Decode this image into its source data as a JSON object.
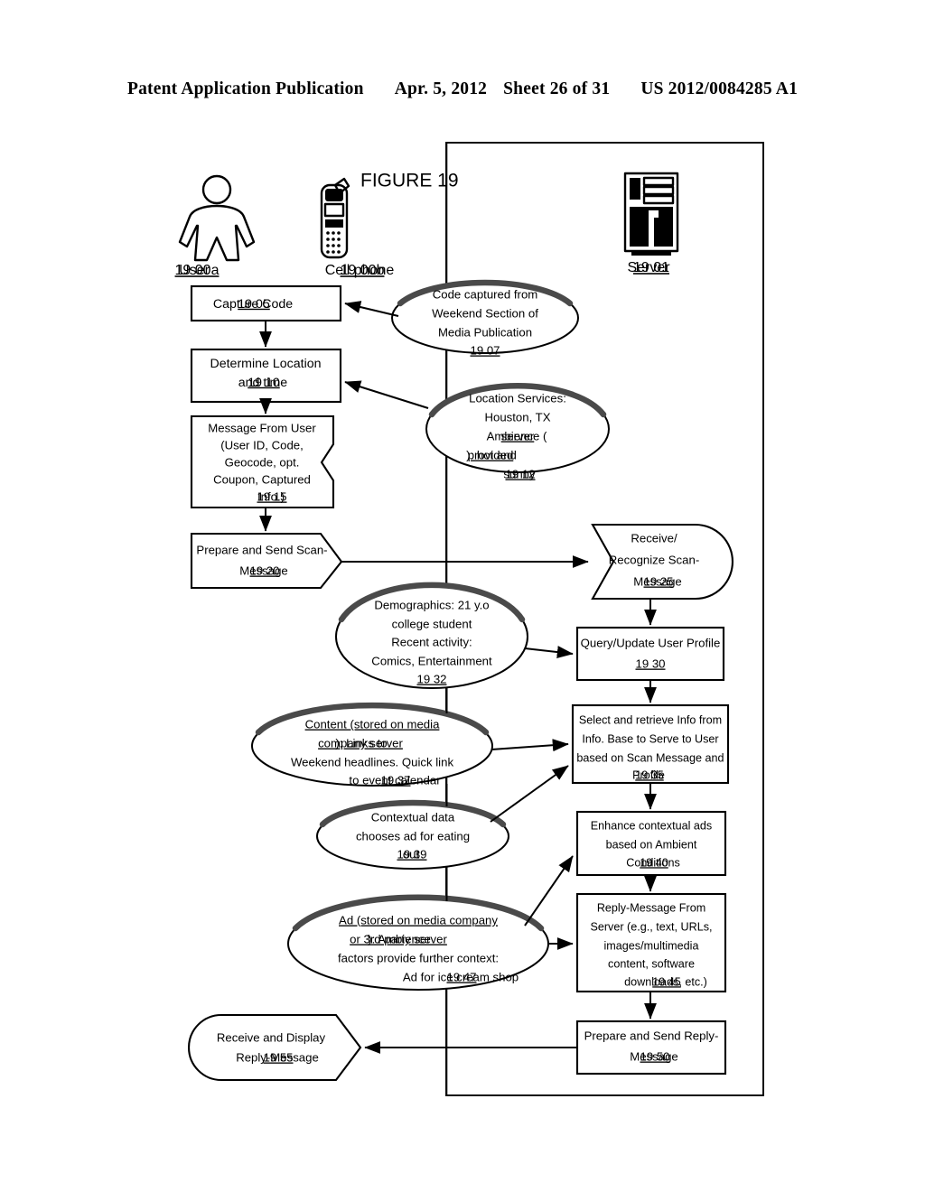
{
  "header": {
    "publication": "Patent Application Publication",
    "date": "Apr. 5, 2012",
    "sheet": "Sheet 26 of 31",
    "number": "US 2012/0084285 A1"
  },
  "figure": {
    "title": "FIGURE 19",
    "actors": [
      {
        "id": "user",
        "icon": "person-icon",
        "label": "User ",
        "ref": "19 00a"
      },
      {
        "id": "phone",
        "icon": "cellphone-icon",
        "label": "Cell phone ",
        "ref": "19 00b"
      },
      {
        "id": "server",
        "icon": "server-icon",
        "label": "Server ",
        "ref": "19 01"
      }
    ],
    "nodes": [
      {
        "id": "n1905",
        "shape": "rect",
        "column": "left",
        "lines": [
          {
            "text": "Capture Code ",
            "ref": "19 05"
          }
        ]
      },
      {
        "id": "n1910",
        "shape": "rect",
        "column": "left",
        "lines": [
          {
            "text": "Determine Location"
          },
          {
            "text": "and time ",
            "ref": "19 10"
          }
        ]
      },
      {
        "id": "n1915",
        "shape": "document",
        "column": "left",
        "lines": [
          {
            "text": "Message From User"
          },
          {
            "text": "(User ID, Code,"
          },
          {
            "text": "Geocode, opt."
          },
          {
            "text": "Coupon, Captured"
          },
          {
            "text": "Info.) ",
            "ref": "19 15"
          }
        ]
      },
      {
        "id": "n1920",
        "shape": "send-arrow",
        "column": "left",
        "lines": [
          {
            "text": "Prepare and Send Scan-"
          },
          {
            "text": "Message ",
            "ref": "19 20"
          }
        ]
      },
      {
        "id": "n1955",
        "shape": "receive-display",
        "column": "left",
        "lines": [
          {
            "text": "Receive and Display"
          },
          {
            "text": "Reply-Message ",
            "ref": "19 55"
          }
        ]
      },
      {
        "id": "n1925",
        "shape": "receive-chevron",
        "column": "right",
        "lines": [
          {
            "text": "Receive/"
          },
          {
            "text": "Recognize Scan-"
          },
          {
            "text": "Message ",
            "ref": "19 25"
          }
        ]
      },
      {
        "id": "n1930",
        "shape": "rect",
        "column": "right",
        "lines": [
          {
            "text": "Query/Update User Profile"
          },
          {
            "text": "",
            "ref": "19 30"
          }
        ]
      },
      {
        "id": "n1935",
        "shape": "rect",
        "column": "right",
        "lines": [
          {
            "text": "Select and retrieve Info from"
          },
          {
            "text": "Info. Base to Serve to User"
          },
          {
            "text": "based on Scan Message and"
          },
          {
            "text": "Profile ",
            "ref": "19 35"
          }
        ]
      },
      {
        "id": "n1940",
        "shape": "rect",
        "column": "right",
        "lines": [
          {
            "text": "Enhance contextual ads"
          },
          {
            "text": "based on Ambient"
          },
          {
            "text": "Conditions ",
            "ref": "19 40"
          }
        ]
      },
      {
        "id": "n1945",
        "shape": "rect",
        "column": "right",
        "lines": [
          {
            "text": "Reply-Message From"
          },
          {
            "text": "Server (e.g., text, URLs,"
          },
          {
            "text": "images/multimedia"
          },
          {
            "text": "content, software"
          },
          {
            "text": "downloads, etc.) ",
            "ref": "19 45"
          }
        ]
      },
      {
        "id": "n1950",
        "shape": "rect",
        "column": "right",
        "lines": [
          {
            "text": "Prepare and Send Reply-"
          },
          {
            "text": "Message ",
            "ref": "19 50"
          }
        ]
      }
    ],
    "ellipses": [
      {
        "id": "e1907",
        "lines": [
          {
            "text": "Code captured from"
          },
          {
            "text": "Weekend Section of"
          },
          {
            "text": "Media Publication"
          },
          {
            "text": "",
            "ref": "19 07"
          }
        ]
      },
      {
        "id": "e1912",
        "lines": [
          {
            "text": "Location Services:"
          },
          {
            "text": "Houston, TX"
          },
          {
            "text": "Ambience (",
            "under": "server",
            "tail": ""
          },
          {
            "under": "provided",
            "tail": "): hot and"
          },
          {
            "text": "sunny ",
            "ref": "19 12"
          }
        ]
      },
      {
        "id": "e1932",
        "lines": [
          {
            "text": "Demographics: 21 y.o"
          },
          {
            "text": "college student"
          },
          {
            "text": "Recent activity:"
          },
          {
            "text": "Comics, Entertainment"
          },
          {
            "text": "",
            "ref": "19 32"
          }
        ]
      },
      {
        "id": "e1937",
        "lines": [
          {
            "under": "Content (stored on media",
            "tail": ""
          },
          {
            "under": "company server",
            "tail": "): Links to"
          },
          {
            "text": "Weekend headlines. Quick link"
          },
          {
            "text": "to event calendar ",
            "ref": "19 37"
          }
        ]
      },
      {
        "id": "e1939",
        "lines": [
          {
            "text": "Contextual data"
          },
          {
            "text": "chooses ad for eating"
          },
          {
            "text": "out ",
            "ref": "19 39"
          }
        ]
      },
      {
        "id": "e1947",
        "lines": [
          {
            "under": "Ad (stored on media company",
            "tail": ""
          },
          {
            "under": "or 3rd party server",
            "tail": "): Ambience"
          },
          {
            "text": "factors provide further context:"
          },
          {
            "text": "Ad for ice cream shop ",
            "ref": "19 47"
          }
        ]
      }
    ]
  }
}
